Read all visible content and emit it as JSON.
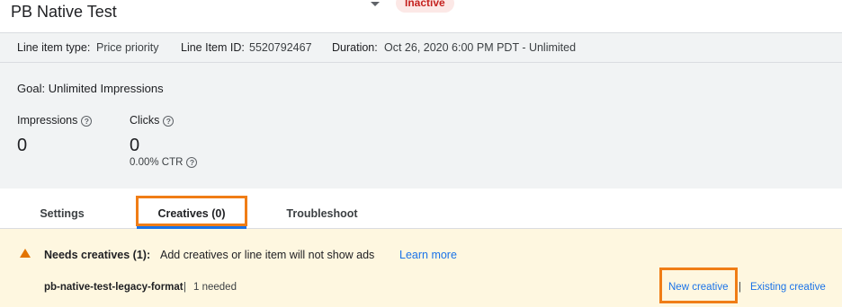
{
  "header": {
    "title": "PB Native Test",
    "status": "Inactive"
  },
  "meta": {
    "line_item_type_label": "Line item type:",
    "line_item_type_value": "Price priority",
    "line_item_id_label": "Line Item ID:",
    "line_item_id_value": "5520792467",
    "duration_label": "Duration:",
    "duration_value": "Oct 26, 2020 6:00 PM PDT - Unlimited"
  },
  "stats": {
    "goal_label": "Goal:",
    "goal_value": "Unlimited Impressions",
    "impressions_label": "Impressions",
    "impressions_value": "0",
    "clicks_label": "Clicks",
    "clicks_value": "0",
    "ctr": "0.00% CTR",
    "help_glyph": "?"
  },
  "tabs": [
    {
      "label": "Settings"
    },
    {
      "label": "Creatives (0)"
    },
    {
      "label": "Troubleshoot"
    }
  ],
  "alert": {
    "title": "Needs creatives (1):",
    "text": "Add creatives or line item will not show ads",
    "learn_more": "Learn more",
    "format_name": "pb-native-test-legacy-format",
    "separator": "|",
    "needed": "1 needed",
    "new_creative": "New creative",
    "existing_creative": "Existing creative"
  },
  "colors": {
    "accent": "#1a73e8",
    "highlight": "#f07d16",
    "status_bg": "#fce8e6",
    "status_text": "#c5221f",
    "alert_bg": "#fef7e0",
    "warning": "#e37400"
  },
  "icons": [
    "help-icon",
    "warning-icon",
    "dropdown-arrow-icon"
  ]
}
